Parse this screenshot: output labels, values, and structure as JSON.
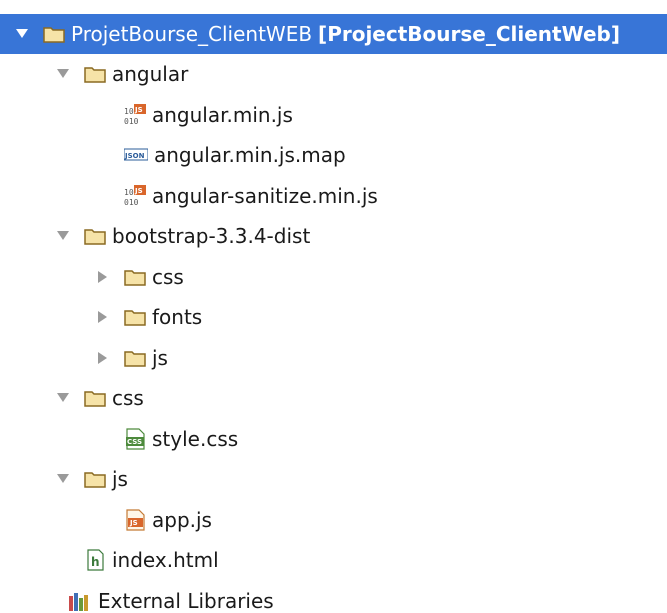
{
  "project": {
    "name": "ProjetBourse_ClientWEB",
    "module": "[ProjectBourse_ClientWeb]",
    "expanded": true
  },
  "nodes": [
    {
      "label": "angular",
      "kind": "folder",
      "depth": 1,
      "arrow": "down"
    },
    {
      "label": "angular.min.js",
      "kind": "js-binary-file",
      "depth": 2,
      "arrow": "none"
    },
    {
      "label": "angular.min.js.map",
      "kind": "json-file",
      "depth": 2,
      "arrow": "none"
    },
    {
      "label": "angular-sanitize.min.js",
      "kind": "js-binary-file",
      "depth": 2,
      "arrow": "none"
    },
    {
      "label": "bootstrap-3.3.4-dist",
      "kind": "folder",
      "depth": 1,
      "arrow": "down"
    },
    {
      "label": "css",
      "kind": "folder",
      "depth": 2,
      "arrow": "right"
    },
    {
      "label": "fonts",
      "kind": "folder",
      "depth": 2,
      "arrow": "right"
    },
    {
      "label": "js",
      "kind": "folder",
      "depth": 2,
      "arrow": "right"
    },
    {
      "label": "css",
      "kind": "folder",
      "depth": 1,
      "arrow": "down"
    },
    {
      "label": "style.css",
      "kind": "css-file",
      "depth": 2,
      "arrow": "none"
    },
    {
      "label": "js",
      "kind": "folder",
      "depth": 1,
      "arrow": "down"
    },
    {
      "label": "app.js",
      "kind": "js-file",
      "depth": 2,
      "arrow": "none"
    },
    {
      "label": "index.html",
      "kind": "html-file",
      "depth": 1,
      "arrow": "none"
    },
    {
      "label": "External Libraries",
      "kind": "libraries",
      "depth": 0,
      "arrow": "none"
    }
  ],
  "colors": {
    "selection": "#3875d7",
    "folder_fill": "#f6e3a8",
    "folder_stroke": "#8a6a22",
    "arrow": "#9a9a9a"
  }
}
